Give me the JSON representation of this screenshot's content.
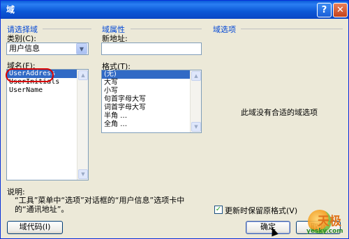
{
  "window": {
    "title": "域",
    "help_glyph": "?",
    "close_glyph": "✕"
  },
  "left_group": {
    "title": "请选择域",
    "category_label": "类别(C):",
    "category_value": "用户信息",
    "field_name_label": "域名(F):",
    "field_names": [
      "UserAddress",
      "UserInitials",
      "UserName"
    ],
    "selected_field": "UserAddress"
  },
  "middle_group": {
    "title": "域属性",
    "new_address_label": "新地址:",
    "new_address_value": "",
    "format_label": "格式(T):",
    "formats": [
      "(无)",
      "大写",
      "小写",
      "句首字母大写",
      "词首字母大写",
      "半角 …",
      "全角 …"
    ],
    "selected_format": "(无)"
  },
  "right_group": {
    "title": "域选项",
    "empty_message": "此域没有合适的域选项"
  },
  "description": {
    "label": "说明:",
    "text_line1": "“工具”菜单中“选项”对话框的“用户信息”选项卡中",
    "text_line2": "的“通讯地址”。"
  },
  "preserve_format": {
    "label": "更新时保留原格式(V)",
    "checked": true
  },
  "buttons": {
    "field_codes": "域代码(I)",
    "ok": "确定",
    "cancel": "取消"
  },
  "watermark": {
    "brand_cn": "天极",
    "brand_en": "yesky.com"
  }
}
